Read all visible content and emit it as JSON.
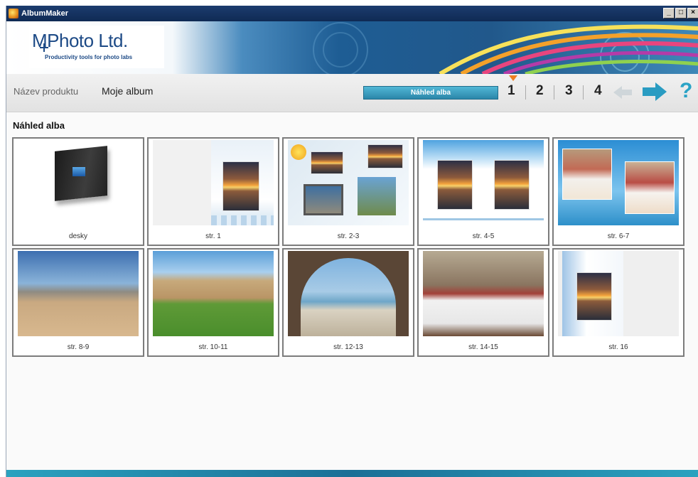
{
  "window": {
    "title": "AlbumMaker",
    "controls": [
      "_",
      "□",
      "×"
    ]
  },
  "brand": {
    "logo_text_a": "M",
    "logo_text_b": "Photo Ltd.",
    "tagline": "Productivity tools for photo labs"
  },
  "toolbar": {
    "product_label": "Název produktu",
    "product_value": "Moje album",
    "preview_button": "Náhled alba",
    "steps": [
      "1",
      "2",
      "3",
      "4"
    ],
    "active_step": "1"
  },
  "section_title": "Náhled alba",
  "pages": [
    {
      "label": "desky"
    },
    {
      "label": "str. 1"
    },
    {
      "label": "str. 2-3"
    },
    {
      "label": "str. 4-5"
    },
    {
      "label": "str. 6-7"
    },
    {
      "label": "str. 8-9"
    },
    {
      "label": "str. 10-11"
    },
    {
      "label": "str. 12-13"
    },
    {
      "label": "str. 14-15"
    },
    {
      "label": "str. 16"
    }
  ],
  "colors": {
    "accent": "#2aa3c6",
    "step_marker": "#ef7d21",
    "titlebar": "#0f2a54"
  }
}
